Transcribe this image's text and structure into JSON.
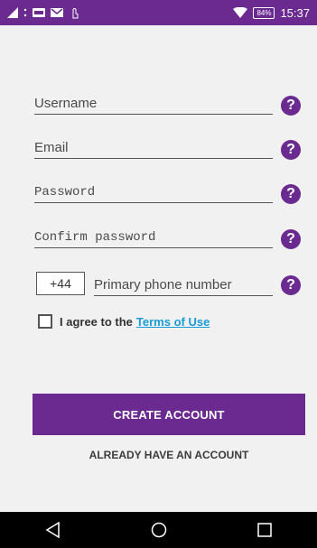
{
  "status_bar": {
    "time": "15:37",
    "battery": "84%",
    "left_icons": [
      "signal-icon",
      "dots-icon",
      "bbm-icon",
      "gmail-icon",
      "touch-icon"
    ],
    "right_icons": [
      "wifi-icon",
      "battery-icon"
    ]
  },
  "form": {
    "username": {
      "placeholder": "Username",
      "value": ""
    },
    "email": {
      "placeholder": "Email",
      "value": ""
    },
    "password": {
      "placeholder": "Password",
      "value": ""
    },
    "confirm_password": {
      "placeholder": "Confirm password",
      "value": ""
    },
    "phone": {
      "country_code": "+44",
      "placeholder": "Primary phone number",
      "value": ""
    },
    "help_label": "?"
  },
  "terms": {
    "prefix": "I agree to the",
    "link": "Terms of Use",
    "checked": false
  },
  "buttons": {
    "create_account": "CREATE ACCOUNT",
    "already_have_account": "ALREADY HAVE AN ACCOUNT"
  },
  "nav_bar": {
    "icons": [
      "back-icon",
      "home-icon",
      "recents-icon"
    ]
  },
  "colors": {
    "primary": "#6b2a8f",
    "link": "#1a9bd7",
    "background": "#f1f1f1"
  }
}
